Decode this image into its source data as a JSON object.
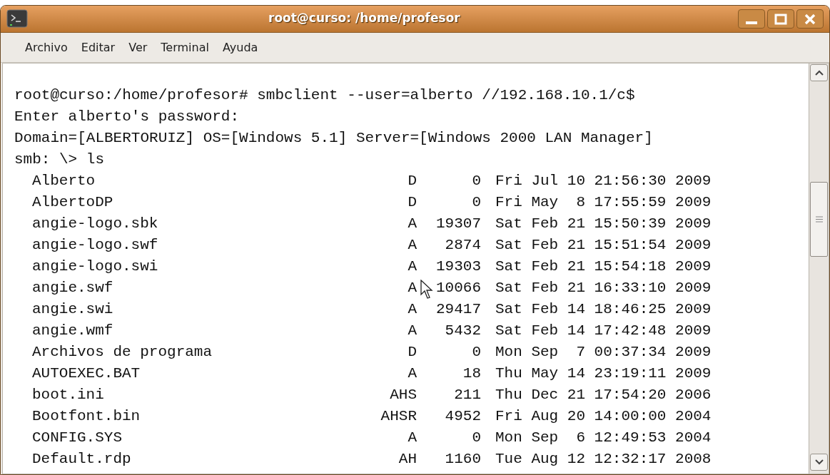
{
  "window": {
    "title": "root@curso: /home/profesor"
  },
  "menu": [
    "Archivo",
    "Editar",
    "Ver",
    "Terminal",
    "Ayuda"
  ],
  "terminal": {
    "lines": [
      "root@curso:/home/profesor# smbclient --user=alberto //192.168.10.1/c$",
      "Enter alberto's password:",
      "Domain=[ALBERTORUIZ] OS=[Windows 5.1] Server=[Windows 2000 LAN Manager]",
      "smb: \\> ls"
    ],
    "listing": [
      {
        "name": "Alberto",
        "attributes": "D",
        "size": "0",
        "date": "Fri Jul 10 21:56:30 2009"
      },
      {
        "name": "AlbertoDP",
        "attributes": "D",
        "size": "0",
        "date": "Fri May  8 17:55:59 2009"
      },
      {
        "name": "angie-logo.sbk",
        "attributes": "A",
        "size": "19307",
        "date": "Sat Feb 21 15:50:39 2009"
      },
      {
        "name": "angie-logo.swf",
        "attributes": "A",
        "size": "2874",
        "date": "Sat Feb 21 15:51:54 2009"
      },
      {
        "name": "angie-logo.swi",
        "attributes": "A",
        "size": "19303",
        "date": "Sat Feb 21 15:54:18 2009"
      },
      {
        "name": "angie.swf",
        "attributes": "A",
        "size": "10066",
        "date": "Sat Feb 21 16:33:10 2009"
      },
      {
        "name": "angie.swi",
        "attributes": "A",
        "size": "29417",
        "date": "Sat Feb 14 18:46:25 2009"
      },
      {
        "name": "angie.wmf",
        "attributes": "A",
        "size": "5432",
        "date": "Sat Feb 14 17:42:48 2009"
      },
      {
        "name": "Archivos de programa",
        "attributes": "D",
        "size": "0",
        "date": "Mon Sep  7 00:37:34 2009"
      },
      {
        "name": "AUTOEXEC.BAT",
        "attributes": "A",
        "size": "18",
        "date": "Thu May 14 23:19:11 2009"
      },
      {
        "name": "boot.ini",
        "attributes": "AHS",
        "size": "211",
        "date": "Thu Dec 21 17:54:20 2006"
      },
      {
        "name": "Bootfont.bin",
        "attributes": "AHSR",
        "size": "4952",
        "date": "Fri Aug 20 14:00:00 2004"
      },
      {
        "name": "CONFIG.SYS",
        "attributes": "A",
        "size": "0",
        "date": "Mon Sep  6 12:49:53 2004"
      },
      {
        "name": "Default.rdp",
        "attributes": "AH",
        "size": "1160",
        "date": "Tue Aug 12 12:32:17 2008"
      }
    ]
  }
}
